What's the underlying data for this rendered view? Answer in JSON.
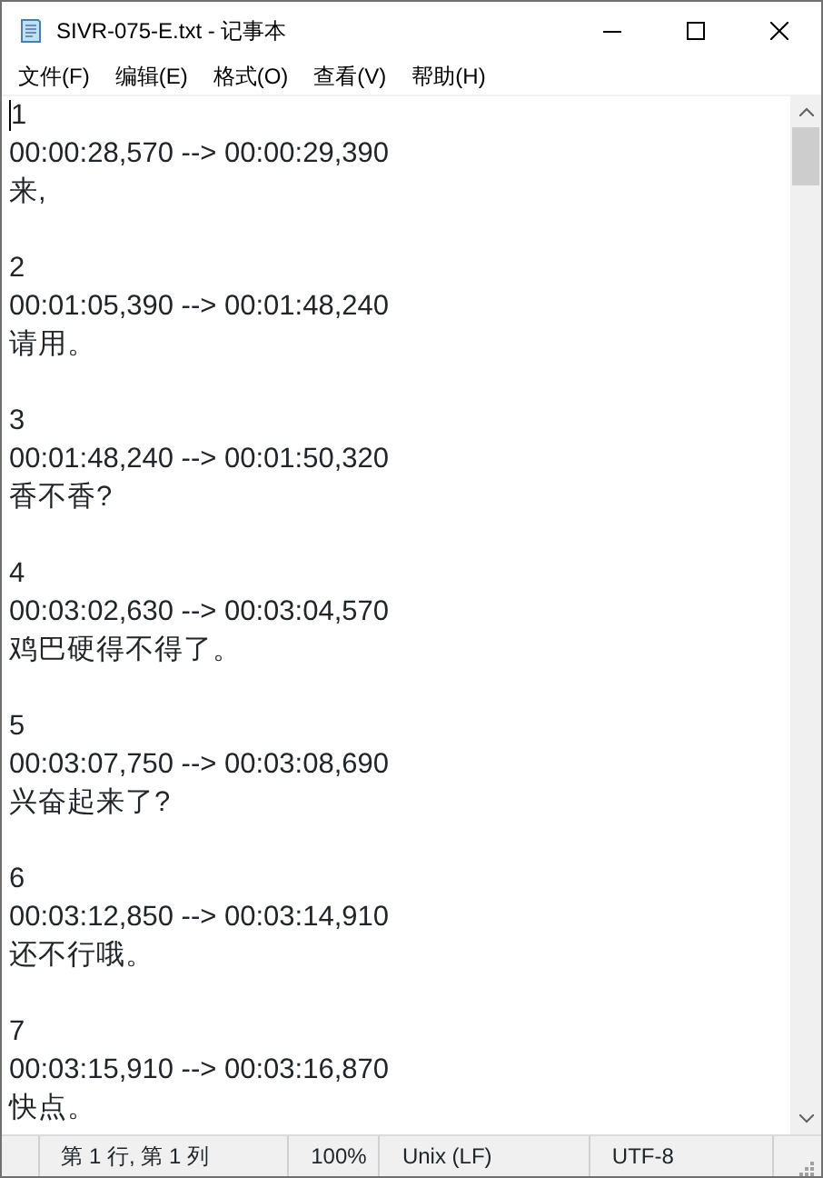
{
  "window": {
    "title": "SIVR-075-E.txt - 记事本"
  },
  "menu": [
    "文件(F)",
    "编辑(E)",
    "格式(O)",
    "查看(V)",
    "帮助(H)"
  ],
  "entries": [
    {
      "index": "1",
      "time": "00:00:28,570 --> 00:00:29,390",
      "text": "来,"
    },
    {
      "index": "2",
      "time": "00:01:05,390 --> 00:01:48,240",
      "text": "请用。"
    },
    {
      "index": "3",
      "time": "00:01:48,240 --> 00:01:50,320",
      "text": "香不香?"
    },
    {
      "index": "4",
      "time": "00:03:02,630 --> 00:03:04,570",
      "text": "鸡巴硬得不得了。"
    },
    {
      "index": "5",
      "time": "00:03:07,750 --> 00:03:08,690",
      "text": "兴奋起来了?"
    },
    {
      "index": "6",
      "time": "00:03:12,850 --> 00:03:14,910",
      "text": "还不行哦。"
    },
    {
      "index": "7",
      "time": "00:03:15,910 --> 00:03:16,870",
      "text": "快点。"
    }
  ],
  "status_bar": {
    "position": "第 1 行, 第 1 列",
    "zoom": "100%",
    "line_ending": "Unix (LF)",
    "encoding": "UTF-8"
  }
}
